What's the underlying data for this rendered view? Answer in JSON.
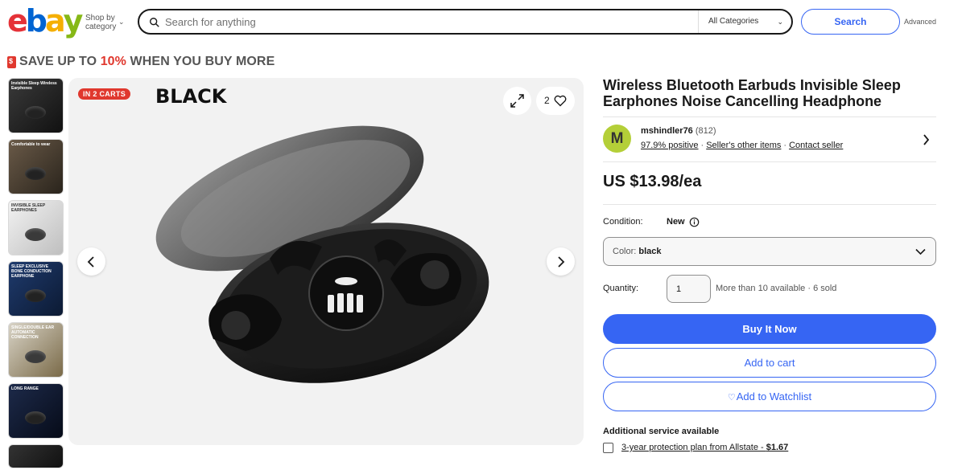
{
  "header": {
    "logo": [
      "e",
      "b",
      "a",
      "y"
    ],
    "shop_by": "Shop by category",
    "search_placeholder": "Search for anything",
    "category": "All Categories",
    "search_button": "Search",
    "advanced": "Advanced"
  },
  "promo": {
    "prefix": "SAVE UP TO ",
    "highlight": "10%",
    "suffix": " WHEN YOU BUY MORE"
  },
  "thumbnails": [
    {
      "icon": "earbud-photo-1",
      "text": "Invisible Sleep Wireless Earphones"
    },
    {
      "icon": "earbud-photo-2",
      "text": "Comfortable to wear"
    },
    {
      "icon": "earbud-photo-3",
      "text": "INVISIBLE SLEEP EARPHONES"
    },
    {
      "icon": "earbud-photo-4",
      "text": "SLEEP EXCLUSIVE BONE CONDUCTION EARPHONE"
    },
    {
      "icon": "earbud-photo-5",
      "text": "SINGLE/DOUBLE EAR AUTOMATIC CONNECTION"
    },
    {
      "icon": "earbud-photo-6",
      "text": "LONG RANGE"
    },
    {
      "icon": "earbud-photo-7",
      "text": ""
    }
  ],
  "gallery": {
    "badge": "IN 2 CARTS",
    "color_title": "BLACK",
    "watch_count": "2"
  },
  "listing": {
    "title": "Wireless Bluetooth Earbuds Invisible Sleep Earphones Noise Cancelling Headphone",
    "seller": {
      "initial": "M",
      "name": "mshindler76",
      "count": "(812)",
      "positive": "97.9% positive",
      "other_items": "Seller's other items",
      "contact": "Contact seller"
    },
    "price": "US $13.98/ea",
    "condition_label": "Condition:",
    "condition_value": "New",
    "color_label": "Color:",
    "color_value": "black",
    "quantity_label": "Quantity:",
    "quantity_value": "1",
    "availability": "More than 10 available · 6 sold",
    "buy_now": "Buy It Now",
    "add_to_cart": "Add to cart",
    "add_to_watchlist": "Add to Watchlist",
    "additional_service": "Additional service available",
    "plan_text": "3-year protection plan from Allstate - ",
    "plan_price": "$1.67"
  },
  "colors": {
    "accent": "#3665f3",
    "badge_red": "#e0382e",
    "avatar": "#b4cf38"
  }
}
